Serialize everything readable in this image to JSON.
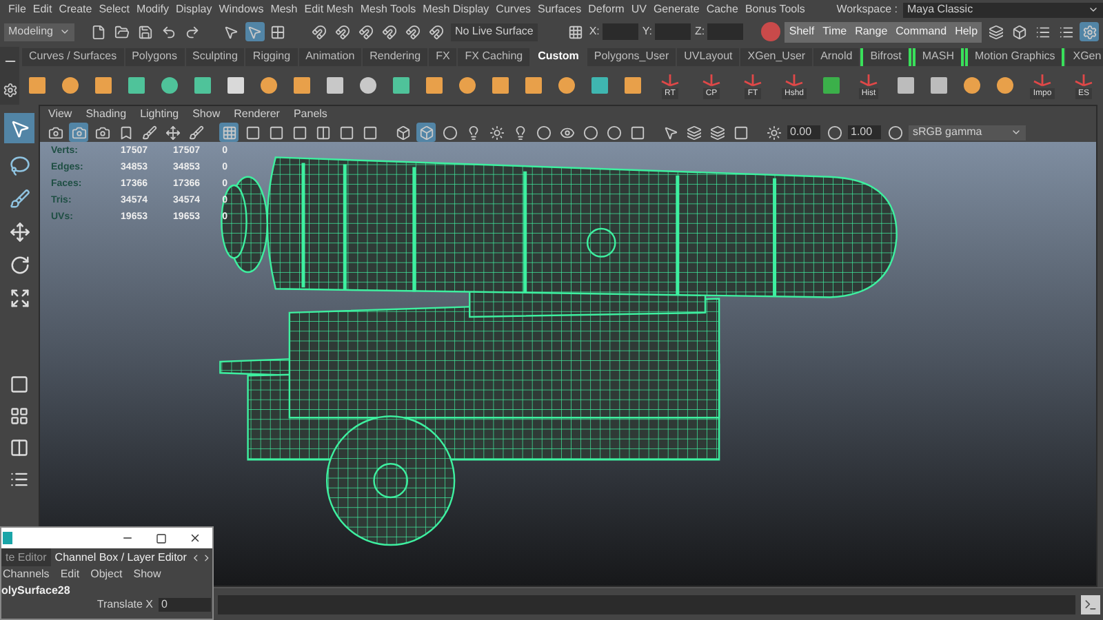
{
  "menu_bar": {
    "items": [
      "File",
      "Edit",
      "Create",
      "Select",
      "Modify",
      "Display",
      "Windows",
      "Mesh",
      "Edit Mesh",
      "Mesh Tools",
      "Mesh Display",
      "Curves",
      "Surfaces",
      "Deform",
      "UV",
      "Generate",
      "Cache",
      "Bonus Tools"
    ],
    "workspace_label": "Workspace :",
    "workspace": "Maya Classic"
  },
  "status_line": {
    "mode": "Modeling",
    "live_surface": "No Live Surface",
    "coord_labels": [
      "X:",
      "Y:",
      "Z:"
    ],
    "buttons": [
      "Shelf",
      "Time",
      "Range",
      "Command",
      "Help"
    ]
  },
  "shelf": {
    "tabs": [
      {
        "label": "Curves / Surfaces",
        "selected": false,
        "bracketed": false
      },
      {
        "label": "Polygons",
        "selected": false,
        "bracketed": false
      },
      {
        "label": "Sculpting",
        "selected": false,
        "bracketed": false
      },
      {
        "label": "Rigging",
        "selected": false,
        "bracketed": false
      },
      {
        "label": "Animation",
        "selected": false,
        "bracketed": false
      },
      {
        "label": "Rendering",
        "selected": false,
        "bracketed": false
      },
      {
        "label": "FX",
        "selected": false,
        "bracketed": false
      },
      {
        "label": "FX Caching",
        "selected": false,
        "bracketed": false
      },
      {
        "label": "Custom",
        "selected": true,
        "bracketed": false
      },
      {
        "label": "Polygons_User",
        "selected": false,
        "bracketed": false
      },
      {
        "label": "UVLayout",
        "selected": false,
        "bracketed": false
      },
      {
        "label": "XGen_User",
        "selected": false,
        "bracketed": false
      },
      {
        "label": "Arnold",
        "selected": false,
        "bracketed": false
      },
      {
        "label": "Bifrost",
        "selected": false,
        "bracketed": true
      },
      {
        "label": "MASH",
        "selected": false,
        "bracketed": true
      },
      {
        "label": "Motion Graphics",
        "selected": false,
        "bracketed": true
      },
      {
        "label": "XGen",
        "selected": false,
        "bracketed": false
      }
    ],
    "button_labels": [
      "RT",
      "CP",
      "FT",
      "Hshd",
      "Hist",
      "Impo",
      "ES"
    ]
  },
  "viewport": {
    "menu": [
      "View",
      "Shading",
      "Lighting",
      "Show",
      "Renderer",
      "Panels"
    ],
    "exposure": "0.00",
    "gamma": "1.00",
    "color_space": "sRGB gamma",
    "hud": [
      {
        "label": "Verts:",
        "values": [
          "17507",
          "17507",
          "0"
        ]
      },
      {
        "label": "Edges:",
        "values": [
          "34853",
          "34853",
          "0"
        ]
      },
      {
        "label": "Faces:",
        "values": [
          "17366",
          "17366",
          "0"
        ]
      },
      {
        "label": "Tris:",
        "values": [
          "34574",
          "34574",
          "0"
        ]
      },
      {
        "label": "UVs:",
        "values": [
          "19653",
          "19653",
          "0"
        ]
      }
    ]
  },
  "channel_box": {
    "tabs": [
      {
        "label": "te Editor",
        "selected": false
      },
      {
        "label": "Channel Box / Layer Editor",
        "selected": true
      }
    ],
    "menu": [
      "Channels",
      "Edit",
      "Object",
      "Show"
    ],
    "object": "olySurface28",
    "attributes": [
      {
        "name": "Translate X",
        "value": "0"
      }
    ]
  }
}
